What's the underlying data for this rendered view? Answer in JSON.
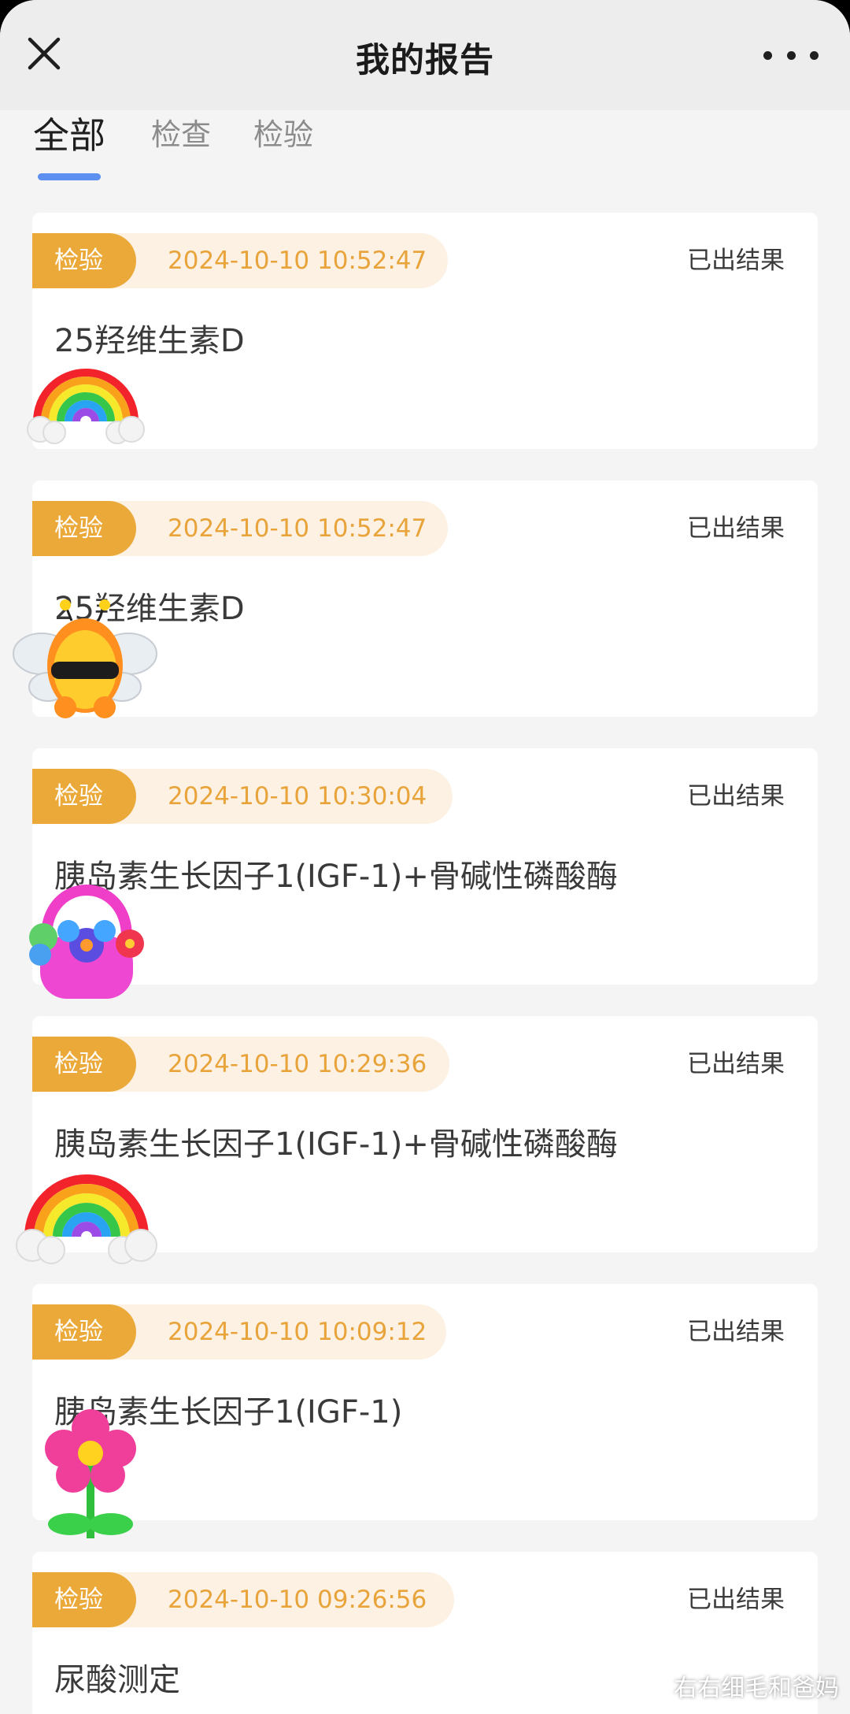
{
  "header": {
    "title": "我的报告"
  },
  "tabs": [
    {
      "label": "全部",
      "active": true
    },
    {
      "label": "检查",
      "active": false
    },
    {
      "label": "检验",
      "active": false
    }
  ],
  "reports": [
    {
      "tag": "检验",
      "datetime": "2024-10-10 10:52:47",
      "status": "已出结果",
      "name": "25羟维生素D",
      "sticker": "rainbow-sticker"
    },
    {
      "tag": "检验",
      "datetime": "2024-10-10 10:52:47",
      "status": "已出结果",
      "name": "25羟维生素D",
      "sticker": "bee-sticker"
    },
    {
      "tag": "检验",
      "datetime": "2024-10-10 10:30:04",
      "status": "已出结果",
      "name": "胰岛素生长因子1(IGF-1)+骨碱性磷酸酶",
      "sticker": "flower-basket-sticker"
    },
    {
      "tag": "检验",
      "datetime": "2024-10-10 10:29:36",
      "status": "已出结果",
      "name": "胰岛素生长因子1(IGF-1)+骨碱性磷酸酶",
      "sticker": "rainbow-sticker"
    },
    {
      "tag": "检验",
      "datetime": "2024-10-10 10:09:12",
      "status": "已出结果",
      "name": "胰岛素生长因子1(IGF-1)",
      "sticker": "flower-sticker"
    },
    {
      "tag": "检验",
      "datetime": "2024-10-10 09:26:56",
      "status": "已出结果",
      "name": "尿酸测定",
      "sticker": ""
    }
  ],
  "watermark": "右右细毛和爸妈",
  "colors": {
    "accent": "#5c8ff0",
    "tag": "#eba93a",
    "date": "#e8a43b"
  }
}
